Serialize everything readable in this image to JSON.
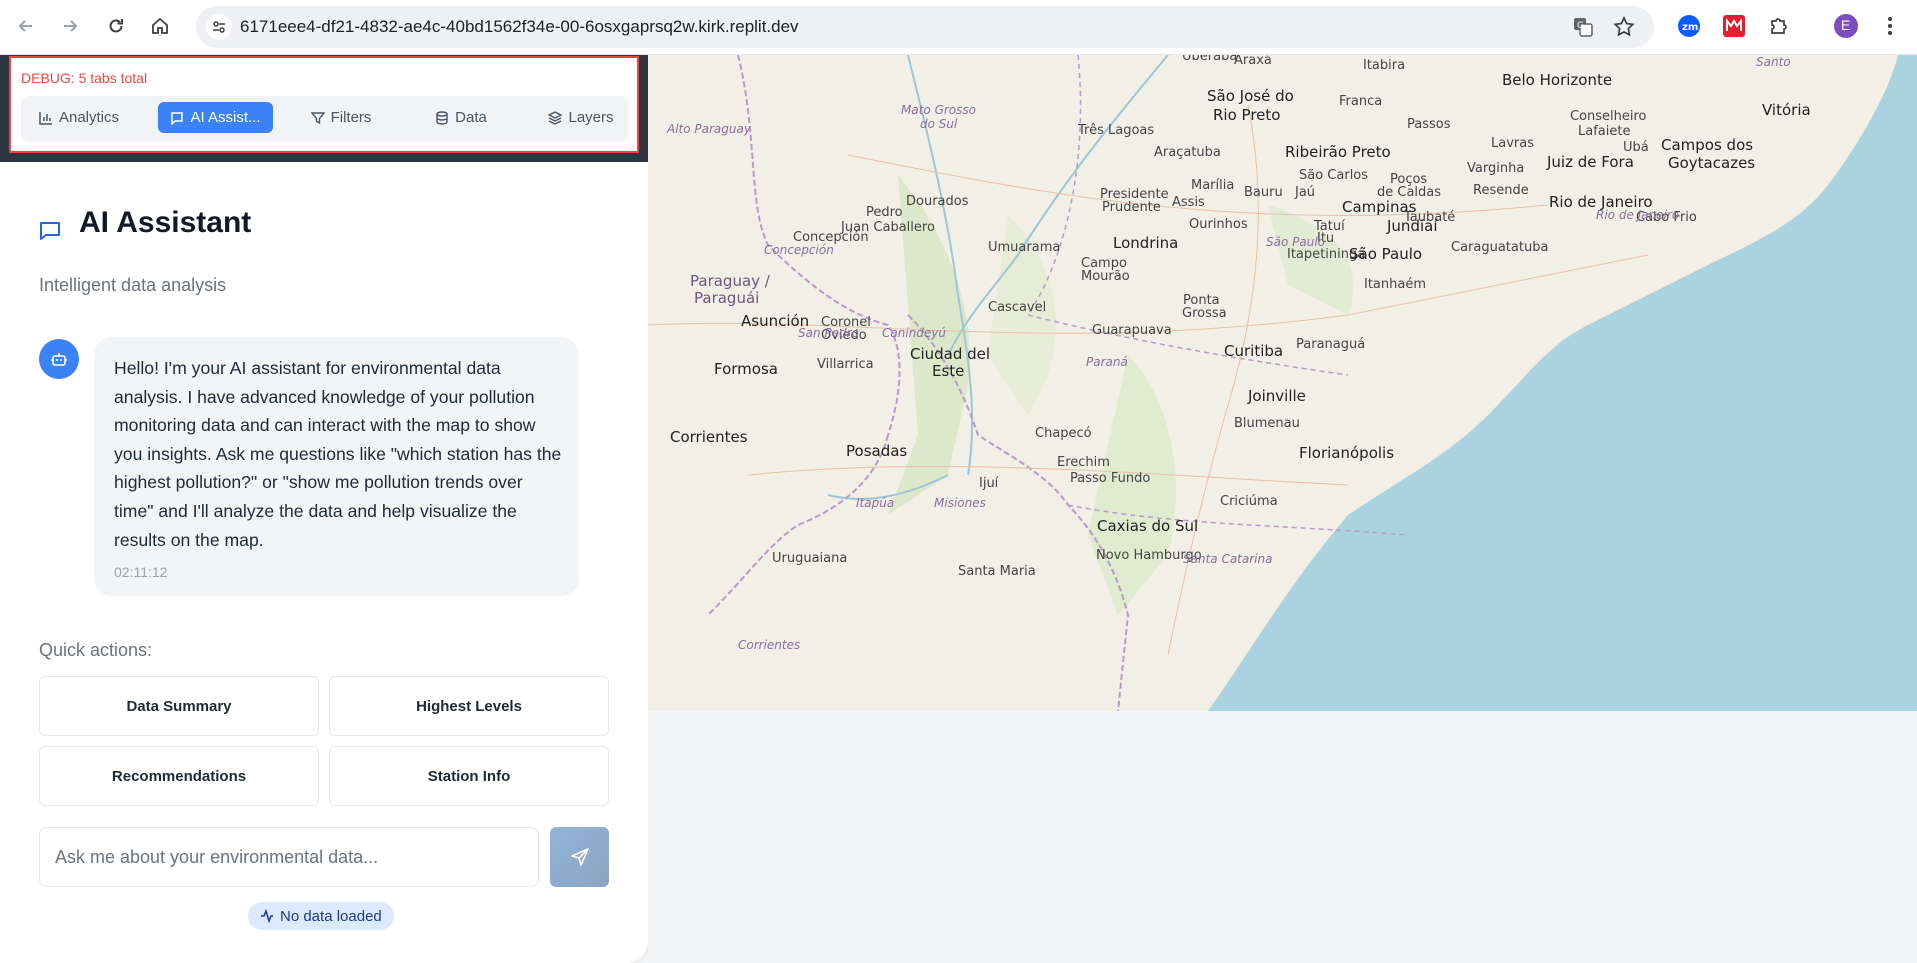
{
  "browser": {
    "url": "6171eee4-df21-4832-ae4c-40bd1562f34e-00-6osxgaprsq2w.kirk.replit.dev",
    "profile_initial": "E",
    "zoom_ext_label": "zm"
  },
  "debug": {
    "text": "DEBUG: 5 tabs total"
  },
  "tabs": [
    {
      "label": "Analytics",
      "icon": "bar-chart-icon"
    },
    {
      "label": "AI Assist...",
      "icon": "chat-icon"
    },
    {
      "label": "Filters",
      "icon": "filter-icon"
    },
    {
      "label": "Data",
      "icon": "database-icon"
    },
    {
      "label": "Layers",
      "icon": "layers-icon"
    }
  ],
  "assistant": {
    "title": "AI Assistant",
    "subtitle": "Intelligent data analysis",
    "message": "Hello! I'm your AI assistant for environmental data analysis. I have advanced knowledge of your pollution monitoring data and can interact with the map to show you insights. Ask me questions like \"which station has the highest pollution?\" or \"show me pollution trends over time\" and I'll analyze the data and help visualize the results on the map.",
    "time": "02:11:12"
  },
  "quick_actions": {
    "label": "Quick actions:",
    "buttons": [
      "Data Summary",
      "Highest Levels",
      "Recommendations",
      "Station Info"
    ]
  },
  "chat": {
    "placeholder": "Ask me about your environmental data...",
    "value": ""
  },
  "status": {
    "text": "No data loaded"
  },
  "map": {
    "cities": [
      "Uberaba",
      "Araxá",
      "Itabira",
      "Belo Horizonte",
      "São José do",
      "Rio Preto",
      "Franca",
      "Passos",
      "Conselheiro",
      "Lafaiete",
      "Ubá",
      "Vitória",
      "Três Lagoas",
      "Araçatuba",
      "Ribeirão Preto",
      "Lavras",
      "Varginha",
      "Juiz de Fora",
      "Campos dos",
      "Goytacazes",
      "Marília",
      "Bauru",
      "São Carlos",
      "Poços",
      "de Caldas",
      "Dourados",
      "Pedro",
      "Juan Caballero",
      "Presidente",
      "Prudente",
      "Assis",
      "Jaú",
      "Campinas",
      "Resende",
      "Rio de Janeiro",
      "Cabo Frio",
      "Concepción",
      "Taubaté",
      "Jundiaí",
      "Umuarama",
      "Londrina",
      "Ourinhos",
      "Tatuí",
      "Itu",
      "Itapetininga",
      "São Paulo",
      "Caraguatatuba",
      "Campo",
      "Mourão",
      "Itanhaém",
      "Asunción",
      "Coronel",
      "Oviedo",
      "Cascavel",
      "Ponta",
      "Grossa",
      "Guarapuava",
      "Curitiba",
      "Paranaguá",
      "Formosa",
      "Villarrica",
      "Ciudad del",
      "Este",
      "Joinville",
      "Blumenau",
      "Corrientes",
      "Posadas",
      "Chapecó",
      "Florianópolis",
      "Erechim",
      "Passo Fundo",
      "Ijuí",
      "Criciúma",
      "Caxias do Sul",
      "Novo Hamburgo",
      "Uruguaiana",
      "Santa Maria"
    ],
    "regions": [
      "Mato Grosso",
      "do Sul",
      "Alto Paraguay",
      "São Paulo",
      "Concepción",
      "San Pedro",
      "Canindeyú",
      "Paraná",
      "Rio de Janeiro",
      "Itapúa",
      "Misiones",
      "Santa Catarina",
      "Corrientes",
      "Santo"
    ],
    "countries": [
      "Paraguay /",
      "Paraguái"
    ]
  }
}
